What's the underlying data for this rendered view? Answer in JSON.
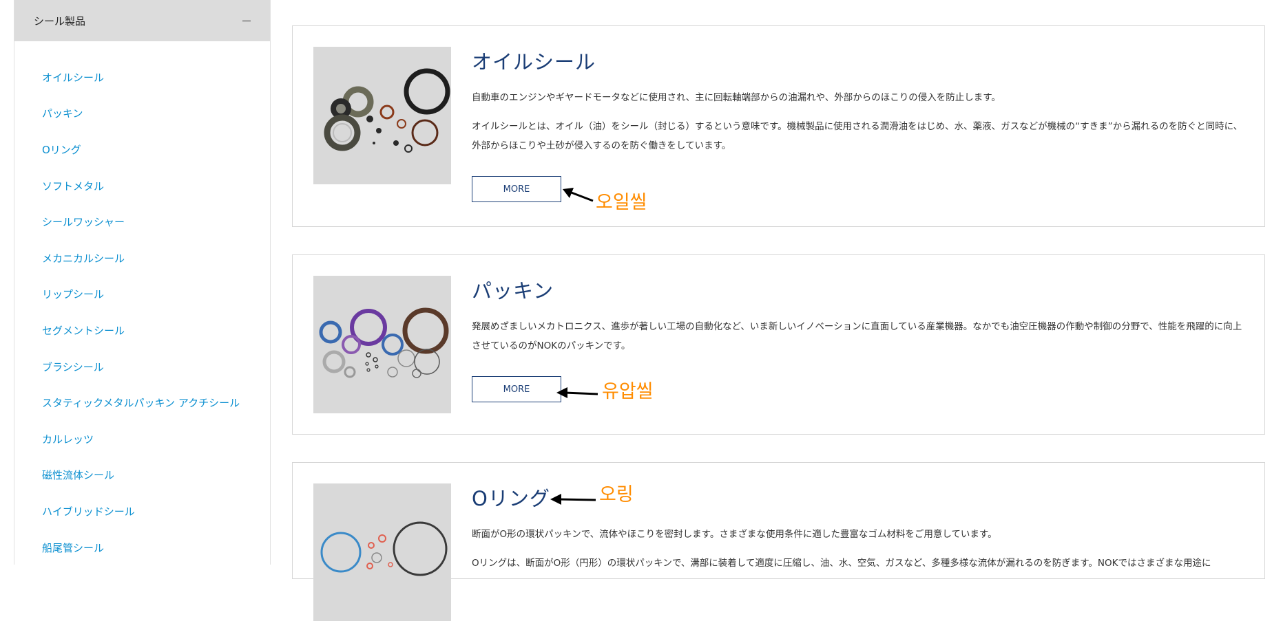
{
  "sidebar": {
    "header": "シール製品",
    "items": [
      "オイルシール",
      "パッキン",
      "Oリング",
      "ソフトメタル",
      "シールワッシャー",
      "メカニカルシール",
      "リップシール",
      "セグメントシール",
      "ブラシシール",
      "スタティックメタルパッキン アクチシール",
      "カルレッツ",
      "磁性流体シール",
      "ハイブリッドシール",
      "船尾管シール"
    ]
  },
  "cards": [
    {
      "title": "オイルシール",
      "paragraphs": [
        "自動車のエンジンやギヤードモータなどに使用され、主に回転軸端部からの油漏れや、外部からのほこりの侵入を防止します。",
        "オイルシールとは、オイル（油）をシール（封じる）するという意味です。機械製品に使用される潤滑油をはじめ、水、薬液、ガスなどが機械の“すきま”から漏れるのを防ぐと同時に、外部からほこりや土砂が侵入するのを防ぐ働きをしています。"
      ],
      "button": "MORE",
      "annotation": "오일씰"
    },
    {
      "title": "パッキン",
      "paragraphs": [
        "発展めざましいメカトロニクス、進歩が著しい工場の自動化など、いま新しいイノベーションに直面している産業機器。なかでも油空圧機器の作動や制御の分野で、性能を飛躍的に向上させているのがNOKのパッキンです。"
      ],
      "button": "MORE",
      "annotation": "유압씰"
    },
    {
      "title": "Oリング",
      "paragraphs": [
        "断面がO形の環状パッキンで、流体やほこりを密封します。さまざまな使用条件に適した豊富なゴム材料をご用意しています。",
        "Oリングは、断面がO形（円形）の環状パッキンで、溝部に装着して適度に圧縮し、油、水、空気、ガスなど、多種多様な流体が漏れるのを防ぎます。NOKではさまざまな用途に"
      ],
      "annotation": "오링"
    }
  ],
  "colors": {
    "link": "#0b8fd0",
    "title": "#1a3d75",
    "annotation": "#ff8c00",
    "sidebar_header_bg": "#dcdcdc"
  }
}
